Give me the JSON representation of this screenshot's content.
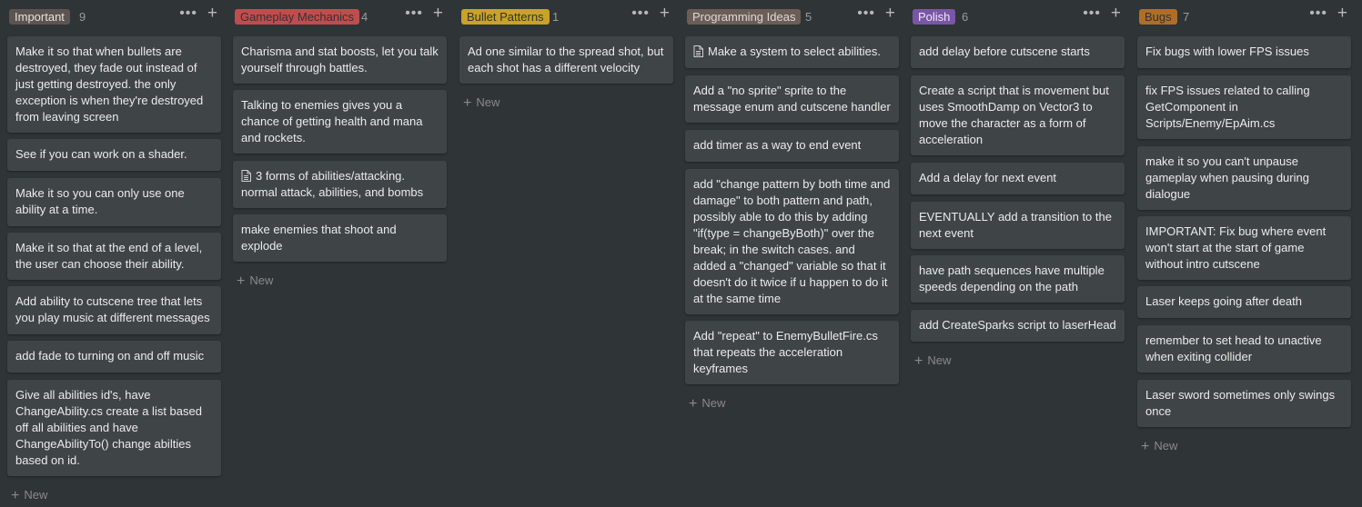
{
  "columns": [
    {
      "label": "Important",
      "count": "9",
      "color": "#5c5450",
      "text_color": "#e6e1dd",
      "cards": [
        "Make it so that when bullets are destroyed, they fade out instead of just getting destroyed. the only exception is when they're destroyed from leaving screen",
        "See if you can work on a shader.",
        "Make it so you can only use one ability at a time.",
        "Make it so that at the end of a level, the user can choose their ability.",
        "Add ability to cutscene tree that lets you play music at different messages",
        "add fade to turning on and off music",
        "Give all abilities id's, have ChangeAbility.cs create a list based off all abilities and have ChangeAbilityTo() change abilties based on id."
      ]
    },
    {
      "label": "Gameplay Mechanics",
      "count": "4",
      "color": "#c04d4d",
      "text_color": "#2f3437",
      "cards": [
        "Charisma and stat boosts, let you talk yourself through battles.",
        "Talking to enemies gives you a chance of getting health and mana and rockets.",
        "3 forms of abilities/attacking. normal attack, abilities, and bombs",
        "make enemies that shoot and explode"
      ]
    },
    {
      "label": "Bullet Patterns",
      "count": "1",
      "color": "#c9a227",
      "text_color": "#2f3437",
      "cards": [
        "Ad one similar to the spread shot, but each shot has a different velocity"
      ]
    },
    {
      "label": "Programming Ideas",
      "count": "5",
      "color": "#6b5d57",
      "text_color": "#e0d6d0",
      "cards": [
        "Make a system to select abilities.",
        "Add a \"no sprite\" sprite to the message enum and cutscene handler",
        "add timer as a way to end event",
        "add \"change pattern by both time and damage\" to both pattern and path, possibly able to do this by adding \"if(type = changeByBoth)\" over the break; in the switch cases. and added a \"changed\" variable so that it doesn't do it twice if u happen to do it at the same time",
        "Add \"repeat\" to EnemyBulletFire.cs that repeats the acceleration keyframes"
      ]
    },
    {
      "label": "Polish",
      "count": "6",
      "color": "#7a56a6",
      "text_color": "#efe8f7",
      "cards": [
        "add delay before cutscene starts",
        "Create a script that is movement but uses SmoothDamp on Vector3 to move  the character as a form of acceleration",
        "Add a delay for next event",
        "EVENTUALLY add a transition to the next event",
        "have path sequences have multiple speeds depending on the path",
        "add CreateSparks script to laserHead"
      ]
    },
    {
      "label": "Bugs",
      "count": "7",
      "color": "#b06d2a",
      "text_color": "#2f3437",
      "cards": [
        "Fix bugs with lower FPS issues",
        "fix FPS issues related to calling GetComponent in Scripts/Enemy/EpAim.cs",
        "make it so you can't unpause gameplay when pausing during dialogue",
        "IMPORTANT: Fix bug where event won't start at the start of game without intro cutscene",
        "Laser keeps going after death",
        "remember to set head to unactive when exiting collider",
        "Laser sword sometimes only swings once"
      ]
    }
  ],
  "new_label": "New",
  "more_icon": "•••",
  "add_icon": "+"
}
